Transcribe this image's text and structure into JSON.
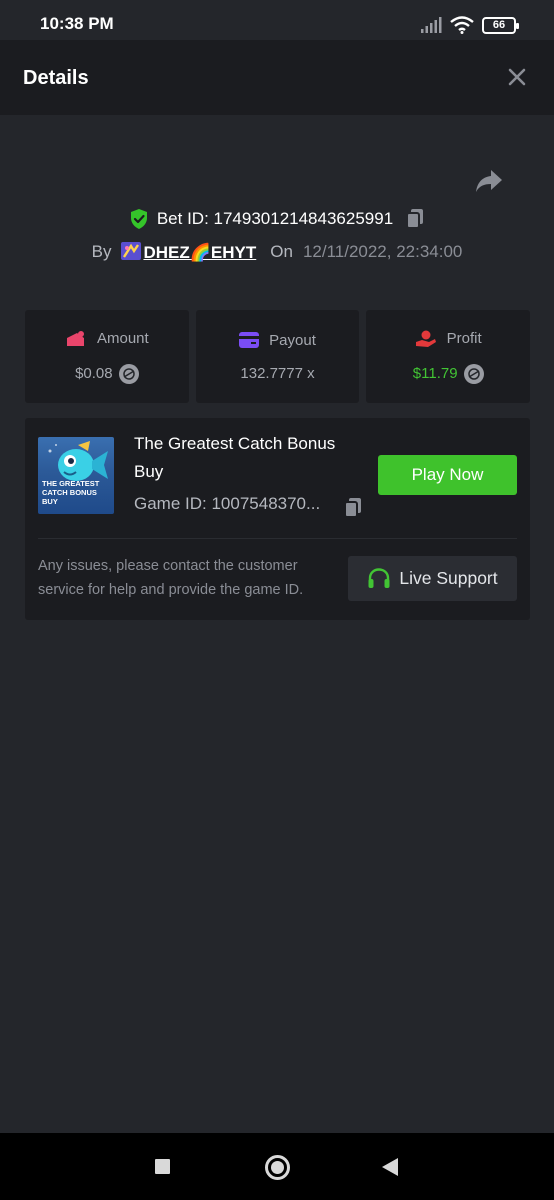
{
  "status_bar": {
    "time": "10:38 PM",
    "battery": "66"
  },
  "header": {
    "title": "Details"
  },
  "bet": {
    "id_label": "Bet ID: 1749301214843625991",
    "by_label": "By",
    "username": "DHEZ🌈EHYT",
    "on_label": "On",
    "date": "12/11/2022, 22:34:00"
  },
  "stats": [
    {
      "label": "Amount",
      "value": "$0.08",
      "icon": "amount-icon",
      "color": "#e9456b"
    },
    {
      "label": "Payout",
      "value": "132.7777 x",
      "icon": "payout-card-icon",
      "color": "#7b4df5"
    },
    {
      "label": "Profit",
      "value": "$11.79",
      "icon": "profit-hand-icon",
      "color": "#e3393b"
    }
  ],
  "game": {
    "title": "The Greatest Catch Bonus Buy",
    "thumb_text": "THE GREATEST CATCH BONUS BUY",
    "game_id": "Game ID: 1007548370...",
    "play_label": "Play Now"
  },
  "help": {
    "text": "Any issues, please contact the customer service for help and provide the game ID.",
    "support_label": "Live Support"
  },
  "colors": {
    "accent_green": "#3fc22c",
    "profit_green": "#42c434",
    "background": "#24262b",
    "card": "#1b1c20"
  }
}
